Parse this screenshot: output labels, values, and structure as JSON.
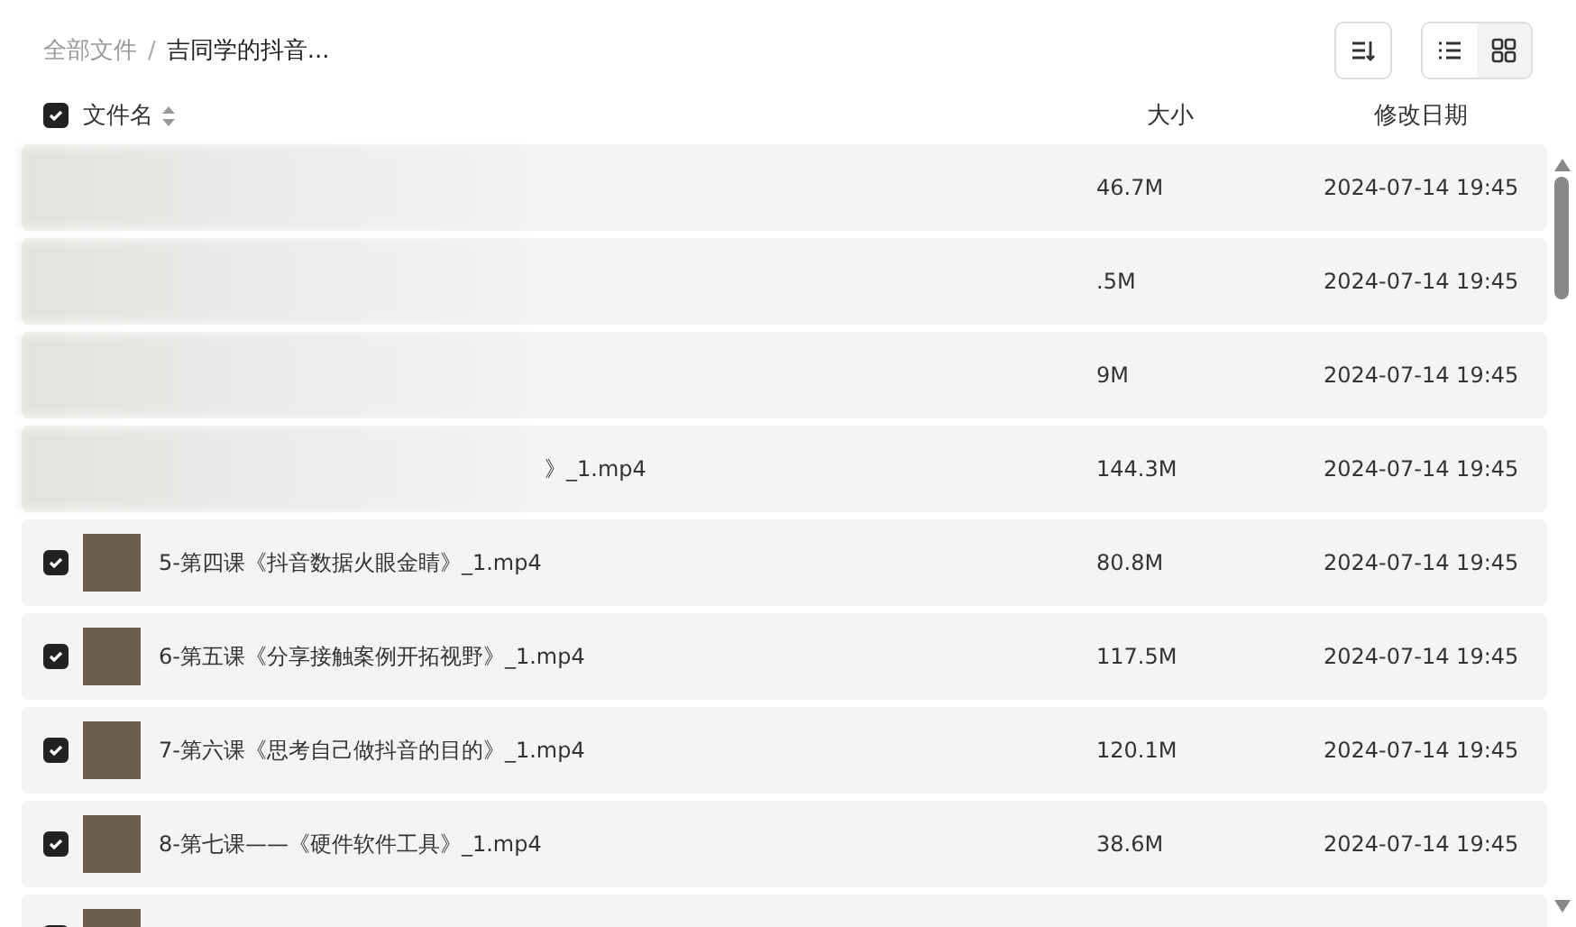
{
  "breadcrumb": [
    {
      "label": "全部文件",
      "current": false
    },
    {
      "label": "吉同学的抖音...",
      "current": true
    }
  ],
  "breadcrumb_separator": "/",
  "view_toggle": [
    {
      "kind": "list",
      "selected": true
    },
    {
      "kind": "grid",
      "selected": false
    }
  ],
  "table": {
    "select_all_checked": true,
    "columns": [
      "文件名",
      "大小",
      "修改日期"
    ],
    "rows": [
      {
        "blurred": true,
        "name": "",
        "size": "46.7M",
        "date": "2024-07-14 19:45"
      },
      {
        "blurred": true,
        "name": "",
        "size": ".5M",
        "date": "2024-07-14 19:45"
      },
      {
        "blurred": true,
        "name": "",
        "size": "9M",
        "date": "2024-07-14 19:45"
      },
      {
        "blurred": true,
        "name": "》_1.mp4",
        "size": "144.3M",
        "date": "2024-07-14 19:45"
      },
      {
        "blurred": false,
        "checked": true,
        "name": "5-第四课《抖音数据火眼金睛》_1.mp4",
        "size": "80.8M",
        "date": "2024-07-14 19:45"
      },
      {
        "blurred": false,
        "checked": true,
        "name": "6-第五课《分享接触案例开拓视野》_1.mp4",
        "size": "117.5M",
        "date": "2024-07-14 19:45"
      },
      {
        "blurred": false,
        "checked": true,
        "name": "7-第六课《思考自己做抖音的目的》_1.mp4",
        "size": "120.1M",
        "date": "2024-07-14 19:45"
      },
      {
        "blurred": false,
        "checked": true,
        "name": "8-第七课——《硬件软件工具》_1.mp4",
        "size": "38.6M",
        "date": "2024-07-14 19:45"
      },
      {
        "blurred": false,
        "checked": true,
        "name": "",
        "size": "",
        "date": ""
      }
    ]
  }
}
